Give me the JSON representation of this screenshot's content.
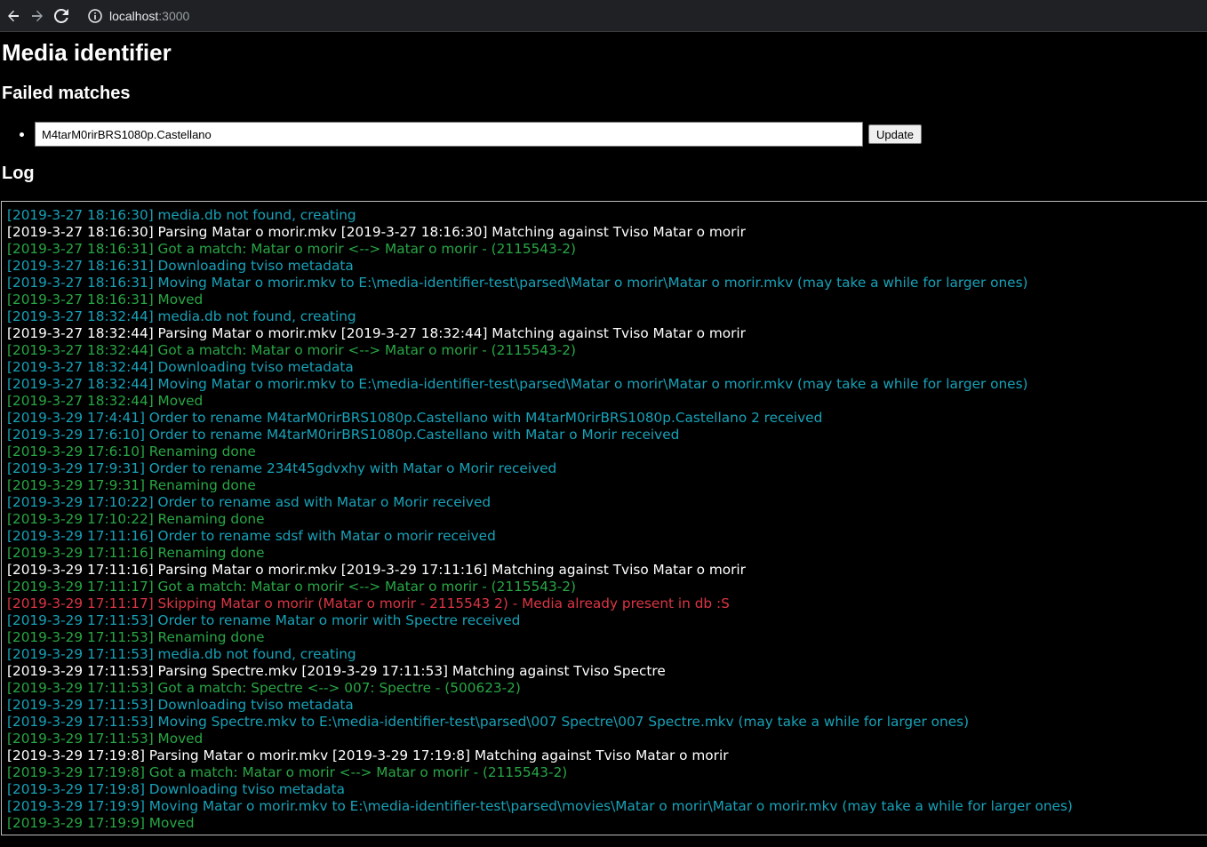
{
  "browser": {
    "url_host": "localhost",
    "url_port": ":3000"
  },
  "page": {
    "title": "Media identifier",
    "failed_heading": "Failed matches",
    "log_heading": "Log"
  },
  "failed_matches": [
    {
      "value": "M4tarM0rirBRS1080p.Castellano",
      "button_label": "Update"
    }
  ],
  "colors": {
    "info": "#17a2b8",
    "parse": "#ffffff",
    "success": "#28a745",
    "error": "#dc3545"
  },
  "log": [
    {
      "type": "info",
      "text": "[2019-3-27 18:16:30] media.db not found, creating"
    },
    {
      "type": "parse",
      "text": "[2019-3-27 18:16:30] Parsing Matar o morir.mkv [2019-3-27 18:16:30] Matching against Tviso Matar o morir"
    },
    {
      "type": "success",
      "text": "[2019-3-27 18:16:31] Got a match: Matar o morir <--> Matar o morir - (2115543-2)"
    },
    {
      "type": "info",
      "text": "[2019-3-27 18:16:31] Downloading tviso metadata"
    },
    {
      "type": "info",
      "text": "[2019-3-27 18:16:31] Moving Matar o morir.mkv to E:\\media-identifier-test\\parsed\\Matar o morir\\Matar o morir.mkv (may take a while for larger ones)"
    },
    {
      "type": "success",
      "text": "[2019-3-27 18:16:31] Moved"
    },
    {
      "type": "info",
      "text": "[2019-3-27 18:32:44] media.db not found, creating"
    },
    {
      "type": "parse",
      "text": "[2019-3-27 18:32:44] Parsing Matar o morir.mkv [2019-3-27 18:32:44] Matching against Tviso Matar o morir"
    },
    {
      "type": "success",
      "text": "[2019-3-27 18:32:44] Got a match: Matar o morir <--> Matar o morir - (2115543-2)"
    },
    {
      "type": "info",
      "text": "[2019-3-27 18:32:44] Downloading tviso metadata"
    },
    {
      "type": "info",
      "text": "[2019-3-27 18:32:44] Moving Matar o morir.mkv to E:\\media-identifier-test\\parsed\\Matar o morir\\Matar o morir.mkv (may take a while for larger ones)"
    },
    {
      "type": "success",
      "text": "[2019-3-27 18:32:44] Moved"
    },
    {
      "type": "info",
      "text": "[2019-3-29 17:4:41] Order to rename M4tarM0rirBRS1080p.Castellano with M4tarM0rirBRS1080p.Castellano 2 received"
    },
    {
      "type": "info",
      "text": "[2019-3-29 17:6:10] Order to rename M4tarM0rirBRS1080p.Castellano with Matar o Morir received"
    },
    {
      "type": "success",
      "text": "[2019-3-29 17:6:10] Renaming done"
    },
    {
      "type": "info",
      "text": "[2019-3-29 17:9:31] Order to rename 234t45gdvxhy with Matar o Morir received"
    },
    {
      "type": "success",
      "text": "[2019-3-29 17:9:31] Renaming done"
    },
    {
      "type": "info",
      "text": "[2019-3-29 17:10:22] Order to rename asd with Matar o Morir received"
    },
    {
      "type": "success",
      "text": "[2019-3-29 17:10:22] Renaming done"
    },
    {
      "type": "info",
      "text": "[2019-3-29 17:11:16] Order to rename sdsf with Matar o morir received"
    },
    {
      "type": "success",
      "text": "[2019-3-29 17:11:16] Renaming done"
    },
    {
      "type": "parse",
      "text": "[2019-3-29 17:11:16] Parsing Matar o morir.mkv [2019-3-29 17:11:16] Matching against Tviso Matar o morir"
    },
    {
      "type": "success",
      "text": "[2019-3-29 17:11:17] Got a match: Matar o morir <--> Matar o morir - (2115543-2)"
    },
    {
      "type": "error",
      "text": "[2019-3-29 17:11:17] Skipping Matar o morir (Matar o morir - 2115543 2) - Media already present in db :S"
    },
    {
      "type": "info",
      "text": "[2019-3-29 17:11:53] Order to rename Matar o morir with Spectre received"
    },
    {
      "type": "success",
      "text": "[2019-3-29 17:11:53] Renaming done"
    },
    {
      "type": "info",
      "text": "[2019-3-29 17:11:53] media.db not found, creating"
    },
    {
      "type": "parse",
      "text": "[2019-3-29 17:11:53] Parsing Spectre.mkv [2019-3-29 17:11:53] Matching against Tviso Spectre"
    },
    {
      "type": "success",
      "text": "[2019-3-29 17:11:53] Got a match: Spectre <--> 007: Spectre - (500623-2)"
    },
    {
      "type": "info",
      "text": "[2019-3-29 17:11:53] Downloading tviso metadata"
    },
    {
      "type": "info",
      "text": "[2019-3-29 17:11:53] Moving Spectre.mkv to E:\\media-identifier-test\\parsed\\007 Spectre\\007 Spectre.mkv (may take a while for larger ones)"
    },
    {
      "type": "success",
      "text": "[2019-3-29 17:11:53] Moved"
    },
    {
      "type": "parse",
      "text": "[2019-3-29 17:19:8] Parsing Matar o morir.mkv [2019-3-29 17:19:8] Matching against Tviso Matar o morir"
    },
    {
      "type": "success",
      "text": "[2019-3-29 17:19:8] Got a match: Matar o morir <--> Matar o morir - (2115543-2)"
    },
    {
      "type": "info",
      "text": "[2019-3-29 17:19:8] Downloading tviso metadata"
    },
    {
      "type": "info",
      "text": "[2019-3-29 17:19:9] Moving Matar o morir.mkv to E:\\media-identifier-test\\parsed\\movies\\Matar o morir\\Matar o morir.mkv (may take a while for larger ones)"
    },
    {
      "type": "success",
      "text": "[2019-3-29 17:19:9] Moved"
    }
  ]
}
